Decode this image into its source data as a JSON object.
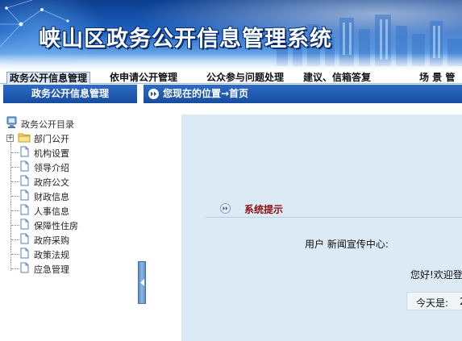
{
  "app": {
    "title": "峡山区政务公开信息管理系统"
  },
  "topnav": {
    "items": [
      {
        "label": "政务公开信息管理",
        "active": true
      },
      {
        "label": "依申请公开管理"
      },
      {
        "label": "公众参与问题处理"
      },
      {
        "label": "建议、信箱答复"
      },
      {
        "label": "场 景 管"
      }
    ]
  },
  "sidebar": {
    "header": "政务公开信息管理",
    "tree": {
      "root_label": "政务公开目录",
      "folder_label": "部门公开",
      "items": [
        {
          "label": "机构设置"
        },
        {
          "label": "领导介绍"
        },
        {
          "label": "政府公文"
        },
        {
          "label": "财政信息"
        },
        {
          "label": "人事信息"
        },
        {
          "label": "保障性住房"
        },
        {
          "label": "政府采购"
        },
        {
          "label": "政策法规"
        },
        {
          "label": "应急管理"
        }
      ]
    }
  },
  "location": {
    "text": "您现在的位置→首页"
  },
  "main": {
    "section_title": "系统提示",
    "user_line": "用户  新闻宣传中心:",
    "welcome": "您好!欢迎登",
    "date_label": "今天是:",
    "date_value": "2"
  },
  "colors": {
    "header_blue": "#164c9f",
    "panel_bg": "#dceaf6",
    "title_red": "#8b1111"
  }
}
